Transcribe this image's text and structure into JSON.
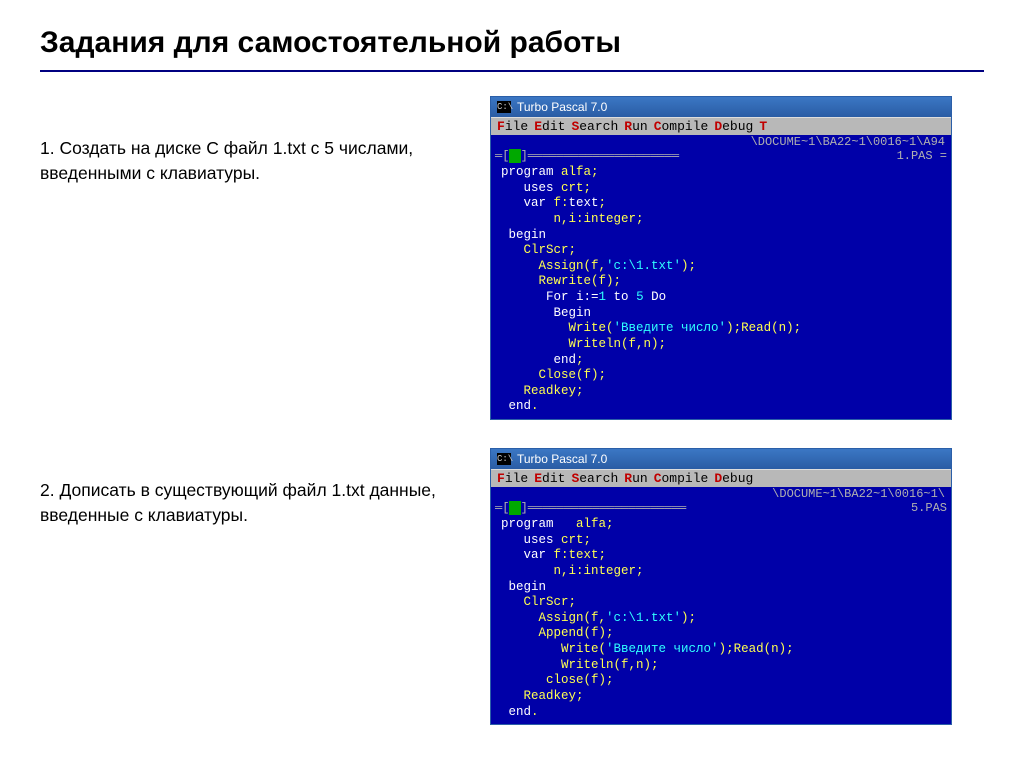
{
  "title": "Задания для самостоятельной работы",
  "task1": "1. Создать на  диске  С  файл  1.txt  с  5 числами,  введенными с клавиатуры.",
  "task2": "2. Дописать в  существующий  файл  1.txt данные,  введенные с клавиатуры.",
  "window_title": "Turbo Pascal 7.0",
  "icon_text": "C:\\",
  "menu": {
    "file": "File",
    "edit": "Edit",
    "search": "Search",
    "run": "Run",
    "compile": "Compile",
    "debug": "Debug",
    "more": "T"
  },
  "path1": "\\DOCUME~1\\BA22~1\\0016~1\\A94",
  "tab1_right": "1.PAS =",
  "path2": "\\DOCUME~1\\BA22~1\\0016~1\\",
  "tab2_right": "5.PAS",
  "code1": {
    "l1a": "program",
    "l1b": " alfa;",
    "l2a": "   uses",
    "l2b": " crt;",
    "l3a": "   var",
    "l3b": " f:",
    "l3c": "text",
    "l3d": ";",
    "l4": "       n,i:integer;",
    "l5": " begin",
    "l6": "   ClrScr;",
    "l7a": "     Assign(f,",
    "l7b": "'c:\\1.txt'",
    "l7c": ");",
    "l8": "     Rewrite(f);",
    "l9a": "      For i:=",
    "l9b": "1",
    "l9c": " to ",
    "l9d": "5",
    "l9e": " Do",
    "l10": "       Begin",
    "l11a": "         Write(",
    "l11b": "'Введите число'",
    "l11c": ");Read(n);",
    "l12": "         Writeln(f,n);",
    "l13": "       end",
    "l13s": ";",
    "l14": "     Close(f);",
    "l15": "   Readkey;",
    "l16": " end",
    "l16d": "."
  },
  "code2": {
    "l1a": "program",
    "l1b": "   alfa;",
    "l2a": "   uses",
    "l2b": " crt;",
    "l3a": "   var",
    "l3b": " f:text;",
    "l4": "       n,i:integer;",
    "l5": " begin",
    "l6": "   ClrScr;",
    "l7a": "     Assign(f,",
    "l7b": "'c:\\1.txt'",
    "l7c": ");",
    "l8": "     Append(f);",
    "l9a": "        Write(",
    "l9b": "'Введите число'",
    "l9c": ");Read(n);",
    "l10": "        Writeln(f,n);",
    "l11": "      close(f);",
    "l12": "   Readkey;",
    "l13": " end",
    "l13d": "."
  }
}
